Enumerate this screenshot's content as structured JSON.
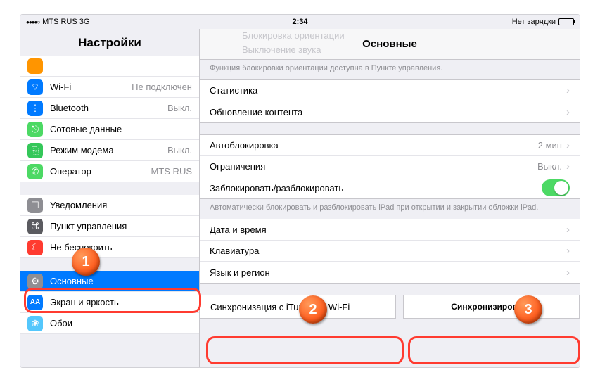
{
  "status": {
    "carrier": "MTS RUS  3G",
    "time": "2:34",
    "battery": "Нет зарядки"
  },
  "sidebar": {
    "title": "Настройки",
    "items": [
      {
        "label": "",
        "val": "",
        "icon": "orange"
      },
      {
        "label": "Wi-Fi",
        "val": "Не подключен",
        "icon": "blue",
        "glyph": "⌔"
      },
      {
        "label": "Bluetooth",
        "val": "Выкл.",
        "icon": "blue",
        "glyph": "⋮"
      },
      {
        "label": "Сотовые данные",
        "val": "",
        "icon": "green",
        "glyph": "⎋"
      },
      {
        "label": "Режим модема",
        "val": "Выкл.",
        "icon": "greenalt",
        "glyph": "⎘"
      },
      {
        "label": "Оператор",
        "val": "MTS RUS",
        "icon": "phone",
        "glyph": "✆"
      }
    ],
    "items2": [
      {
        "label": "Уведомления",
        "val": "",
        "icon": "grey",
        "glyph": "☐"
      },
      {
        "label": "Пункт управления",
        "val": "",
        "icon": "darkgrey",
        "glyph": "⌘"
      },
      {
        "label": "Не беспокоить",
        "val": "",
        "icon": "red",
        "glyph": "☾"
      }
    ],
    "items3": [
      {
        "label": "Основные",
        "val": "",
        "icon": "greygear",
        "glyph": "⚙",
        "selected": true
      },
      {
        "label": "Экран и яркость",
        "val": "",
        "icon": "aa",
        "glyph": "AA"
      },
      {
        "label": "Обои",
        "val": "",
        "icon": "wall",
        "glyph": "❀"
      }
    ]
  },
  "detail": {
    "ghost1": "Блокировка ориентации",
    "ghost2": "Выключение звука",
    "title": "Основные",
    "foot1": "Функция блокировки ориентации доступна в Пункте управления.",
    "g1": [
      {
        "label": "Статистика"
      },
      {
        "label": "Обновление контента"
      }
    ],
    "g2": [
      {
        "label": "Автоблокировка",
        "val": "2 мин"
      },
      {
        "label": "Ограничения",
        "val": "Выкл."
      },
      {
        "label": "Заблокировать/разблокировать",
        "switch": true
      }
    ],
    "foot2": "Автоматически блокировать и разблокировать iPad при открытии и закрытии обложки iPad.",
    "g3": [
      {
        "label": "Дата и время"
      },
      {
        "label": "Клавиатура"
      },
      {
        "label": "Язык и регион"
      }
    ],
    "sync_label": "Синхронизация с iTunes по Wi-Fi",
    "sync_btn": "Синхронизировать"
  },
  "annot": {
    "a1": "1",
    "a2": "2",
    "a3": "3"
  }
}
